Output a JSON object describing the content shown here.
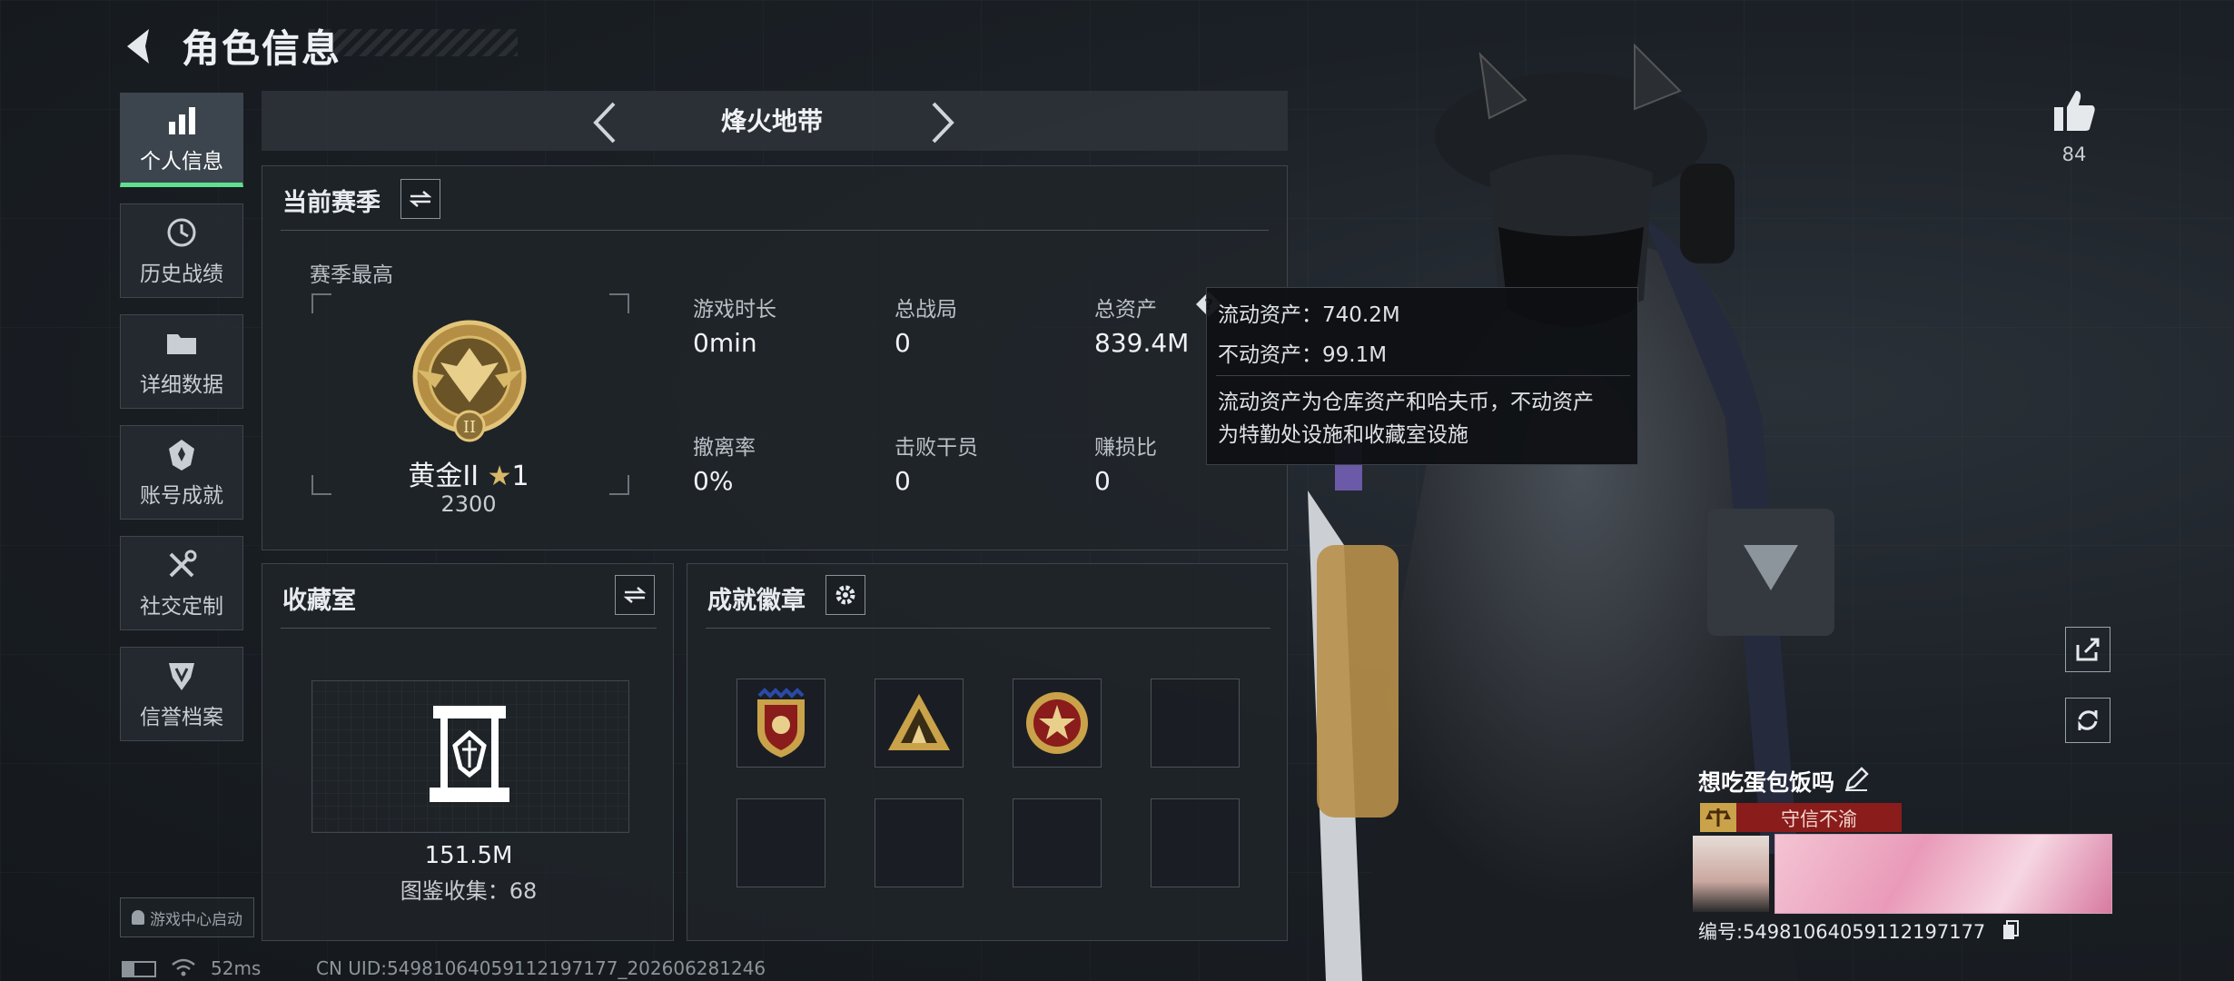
{
  "header": {
    "title": "角色信息"
  },
  "sidebar": {
    "items": [
      {
        "label": "个人信息",
        "icon": "bar-chart-icon",
        "active": true
      },
      {
        "label": "历史战绩",
        "icon": "history-clock-icon"
      },
      {
        "label": "详细数据",
        "icon": "folder-icon"
      },
      {
        "label": "账号成就",
        "icon": "achievement-icon"
      },
      {
        "label": "社交定制",
        "icon": "tools-icon"
      },
      {
        "label": "信誉档案",
        "icon": "shield-credit-icon"
      }
    ],
    "launch_label": "游戏中心启动"
  },
  "mode_bar": {
    "label": "烽火地带"
  },
  "season": {
    "title": "当前赛季",
    "best_label": "赛季最高",
    "rank_name": "黄金II",
    "rank_stars": "1",
    "rank_score": "2300",
    "stats": [
      {
        "label": "游戏时长",
        "value": "0min"
      },
      {
        "label": "总战局",
        "value": "0"
      },
      {
        "label": "总资产",
        "value": "839.4M"
      },
      {
        "label": "撤离率",
        "value": "0%"
      },
      {
        "label": "击败干员",
        "value": "0"
      },
      {
        "label": "赚损比",
        "value": "0"
      }
    ]
  },
  "tooltip": {
    "liquid": "流动资产：740.2M",
    "fixed": "不动资产：99.1M",
    "desc_line1": "流动资产为仓库资产和哈夫币，不动资产",
    "desc_line2": "为特勤处设施和收藏室设施"
  },
  "collection": {
    "title": "收藏室",
    "value": "151.5M",
    "catalog": "图鉴收集：68"
  },
  "achievements": {
    "title": "成就徽章"
  },
  "right": {
    "likes": "84",
    "player_name": "想吃蛋包饭吗",
    "reputation_tag": "守信不渝",
    "id_text": "编号:54981064059112197177"
  },
  "footer": {
    "ping": "52ms",
    "uid": "CN UID:54981064059112197177_202606281246"
  },
  "colors": {
    "accent": "#5fe08f",
    "gold": "#c9a24a",
    "reputation_red": "#8a1c1c"
  }
}
